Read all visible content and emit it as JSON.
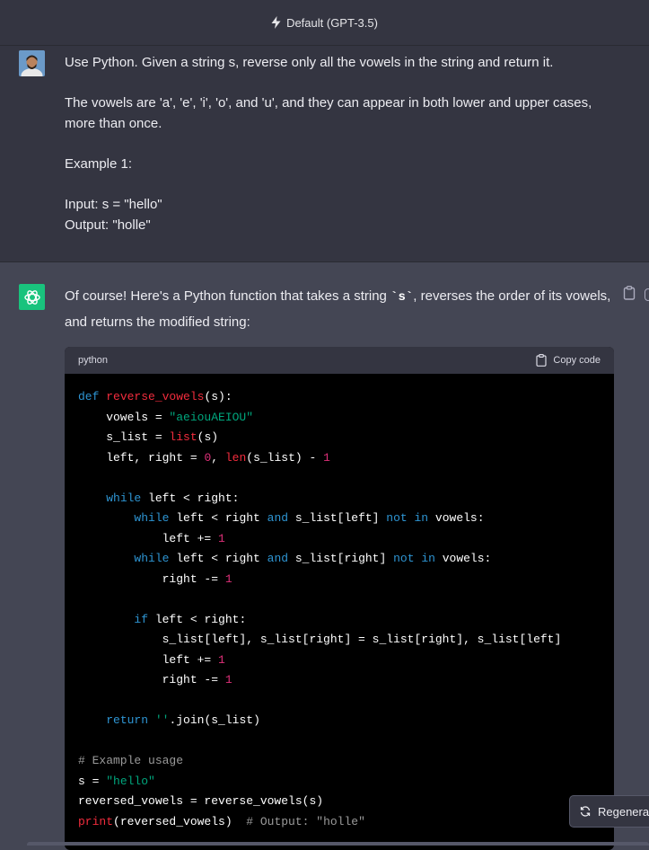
{
  "header": {
    "model_label": "Default (GPT-3.5)",
    "icon": "lightning-icon"
  },
  "user_message": {
    "paragraphs": [
      "Use Python. Given a string s, reverse only all the vowels in the string and return it.",
      "The vowels are 'a', 'e', 'i', 'o', and 'u', and they can appear in both lower and upper cases, more than once.",
      "Example 1:"
    ],
    "example_input": "Input: s = \"hello\"",
    "example_output": "Output: \"holle\""
  },
  "assistant_message": {
    "intro_before": "Of course! Here's a Python function that takes a string ",
    "intro_code": "`s`",
    "intro_after": ", reverses the order of its vowels, and returns the modified string:",
    "code_language": "python",
    "copy_label": "Copy code"
  },
  "regenerate_label": "Regenerate",
  "colors": {
    "keyword": "#2e95d3",
    "function": "#f22c3d",
    "string": "#00a67d",
    "number": "#df3079",
    "comment": "#9a9a9a",
    "gpt_green": "#19c37d"
  }
}
